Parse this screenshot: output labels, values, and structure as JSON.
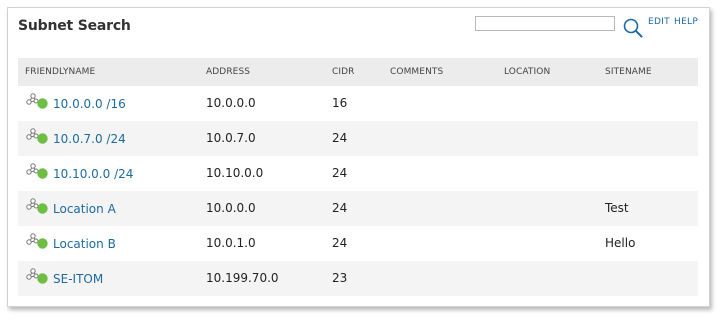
{
  "panel": {
    "title": "Subnet Search"
  },
  "search": {
    "value": "",
    "placeholder": ""
  },
  "toolbar": {
    "edit_label": "EDIT",
    "help_label": "HELP"
  },
  "table": {
    "headers": {
      "name": "FRIENDLYNAME",
      "address": "ADDRESS",
      "cidr": "CIDR",
      "comments": "COMMENTS",
      "location": "LOCATION",
      "sitename": "SITENAME"
    },
    "rows": [
      {
        "name": "10.0.0.0 /16",
        "address": "10.0.0.0",
        "cidr": "16",
        "comments": "",
        "location": "",
        "sitename": "",
        "status": "up"
      },
      {
        "name": "10.0.7.0 /24",
        "address": "10.0.7.0",
        "cidr": "24",
        "comments": "",
        "location": "",
        "sitename": "",
        "status": "up"
      },
      {
        "name": "10.10.0.0 /24",
        "address": "10.10.0.0",
        "cidr": "24",
        "comments": "",
        "location": "",
        "sitename": "",
        "status": "up"
      },
      {
        "name": "Location A",
        "address": "10.0.0.0",
        "cidr": "24",
        "comments": "",
        "location": "",
        "sitename": "Test",
        "status": "up"
      },
      {
        "name": "Location B",
        "address": "10.0.1.0",
        "cidr": "24",
        "comments": "",
        "location": "",
        "sitename": "Hello",
        "status": "up"
      },
      {
        "name": "SE-ITOM",
        "address": "10.199.70.0",
        "cidr": "23",
        "comments": "",
        "location": "",
        "sitename": "",
        "status": "up"
      }
    ]
  },
  "icons": {
    "row_icon": "subnet-node-icon",
    "status_icon": "status-up-icon",
    "search_icon": "search-icon"
  },
  "colors": {
    "link": "#1d6aa0",
    "status_up": "#6fbe44",
    "header_bg": "#ececec",
    "alt_row_bg": "#f4f4f4"
  }
}
